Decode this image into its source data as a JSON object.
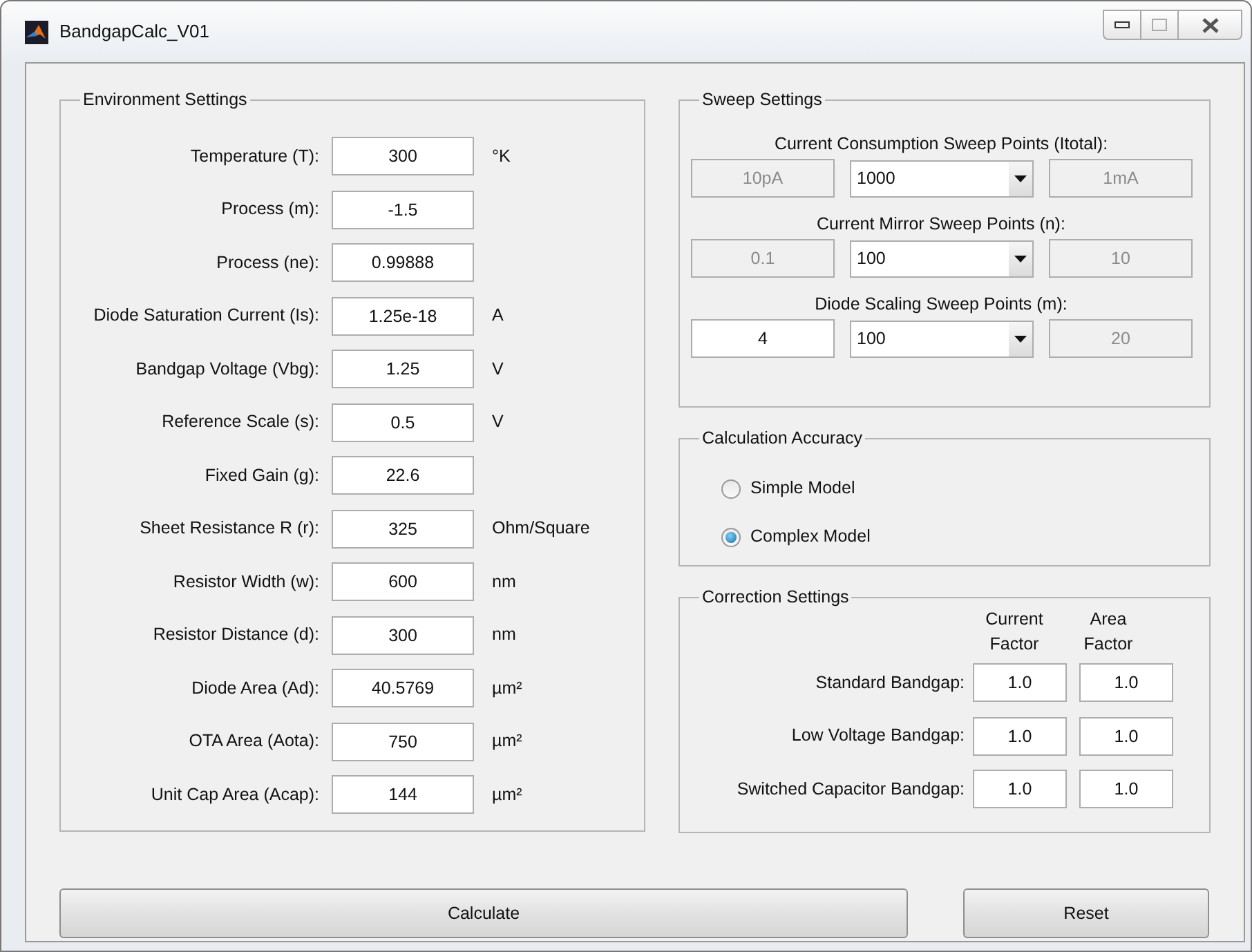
{
  "window": {
    "title": "BandgapCalc_V01"
  },
  "environment": {
    "title": "Environment Settings",
    "fields": [
      {
        "label": "Temperature (T):",
        "value": "300",
        "unit": "°K"
      },
      {
        "label": "Process (m):",
        "value": "-1.5"
      },
      {
        "label": "Process (ne):",
        "value": "0.99888"
      },
      {
        "label": "Diode Saturation Current (Is):",
        "value": "1.25e-18",
        "unit": "A"
      },
      {
        "label": "Bandgap Voltage (Vbg):",
        "value": "1.25",
        "unit": "V"
      },
      {
        "label": "Reference Scale (s):",
        "value": "0.5",
        "unit": "V"
      },
      {
        "label": "Fixed Gain (g):",
        "value": "22.6"
      },
      {
        "label": "Sheet Resistance R (r):",
        "value": "325",
        "unit": "Ohm/Square"
      },
      {
        "label": "Resistor Width (w):",
        "value": "600",
        "unit": "nm"
      },
      {
        "label": "Resistor Distance (d):",
        "value": "300",
        "unit": "nm"
      },
      {
        "label": "Diode Area (Ad):",
        "value": "40.5769",
        "unit": "µm²"
      },
      {
        "label": "OTA Area (Aota):",
        "value": "750",
        "unit": "µm²"
      },
      {
        "label": "Unit Cap Area (Acap):",
        "value": "144",
        "unit": "µm²"
      }
    ]
  },
  "sweep": {
    "title": "Sweep Settings",
    "groups": [
      {
        "label": "Current Consumption Sweep Points (Itotal):",
        "start": {
          "value": "10pA",
          "disabled": true
        },
        "points": "1000",
        "end": {
          "value": "1mA",
          "disabled": true
        }
      },
      {
        "label": "Current Mirror Sweep Points (n):",
        "start": {
          "value": "0.1",
          "disabled": true
        },
        "points": "100",
        "end": {
          "value": "10",
          "disabled": true
        }
      },
      {
        "label": "Diode Scaling Sweep Points (m):",
        "start": {
          "value": "4",
          "disabled": false
        },
        "points": "100",
        "end": {
          "value": "20",
          "disabled": true
        }
      }
    ]
  },
  "accuracy": {
    "title": "Calculation Accuracy",
    "options": [
      {
        "label": "Simple Model",
        "selected": false
      },
      {
        "label": "Complex Model",
        "selected": true
      }
    ]
  },
  "correction": {
    "title": "Correction Settings",
    "columns": [
      "Current Factor",
      "Area Factor"
    ],
    "rows": [
      {
        "label": "Standard Bandgap:",
        "values": [
          "1.0",
          "1.0"
        ]
      },
      {
        "label": "Low Voltage Bandgap:",
        "values": [
          "1.0",
          "1.0"
        ]
      },
      {
        "label": "Switched Capacitor Bandgap:",
        "values": [
          "1.0",
          "1.0"
        ]
      }
    ]
  },
  "buttons": [
    {
      "label": "Calculate",
      "kind": "wide"
    },
    {
      "label": "Reset",
      "kind": "narrow"
    }
  ]
}
